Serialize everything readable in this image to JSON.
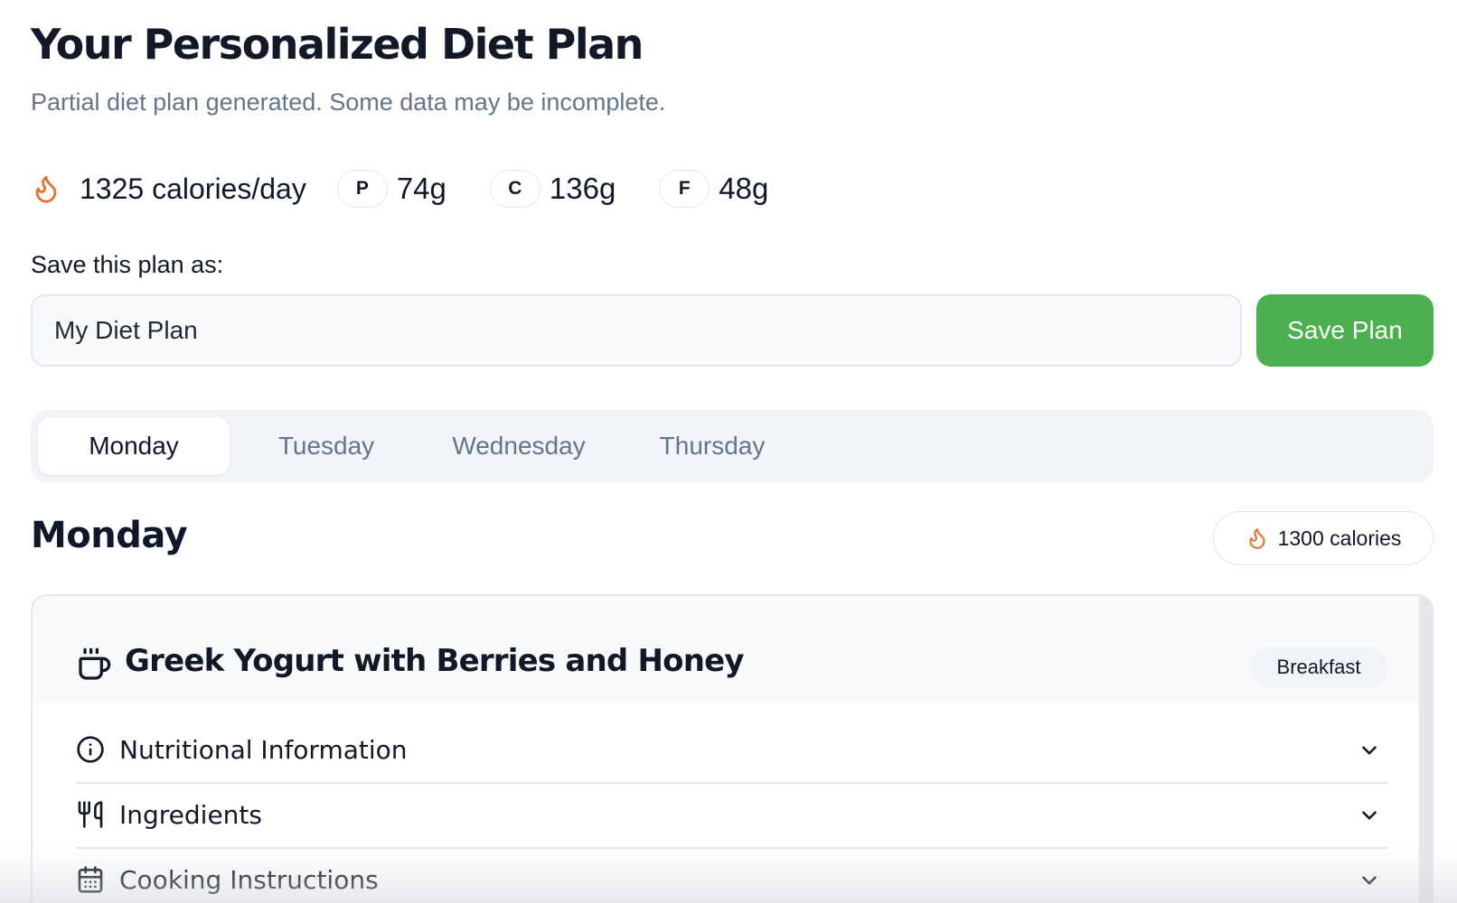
{
  "header": {
    "title": "Your Personalized Diet Plan",
    "subtitle": "Partial diet plan generated. Some data may be incomplete."
  },
  "summary": {
    "calories": "1325 calories/day",
    "calories_icon": "flame-icon",
    "macros": [
      {
        "letter": "P",
        "value": "74g"
      },
      {
        "letter": "C",
        "value": "136g"
      },
      {
        "letter": "F",
        "value": "48g"
      }
    ]
  },
  "save": {
    "label": "Save this plan as:",
    "input_value": "My Diet Plan",
    "button_label": "Save Plan",
    "button_color": "#4caf50"
  },
  "tabs": [
    {
      "label": "Monday",
      "active": true
    },
    {
      "label": "Tuesday",
      "active": false
    },
    {
      "label": "Wednesday",
      "active": false
    },
    {
      "label": "Thursday",
      "active": false
    }
  ],
  "day": {
    "title": "Monday",
    "calories_badge": "1300 calories"
  },
  "meal": {
    "title": "Greek Yogurt with Berries and Honey",
    "type_badge": "Breakfast",
    "icon": "coffee-cup-icon",
    "sections": [
      {
        "label": "Nutritional Information",
        "icon": "info-icon"
      },
      {
        "label": "Ingredients",
        "icon": "utensils-icon"
      },
      {
        "label": "Cooking Instructions",
        "icon": "calendar-icon"
      }
    ]
  },
  "colors": {
    "accent_flame": "#e8742a",
    "muted_text": "#64748b",
    "save_green": "#4caf50"
  }
}
